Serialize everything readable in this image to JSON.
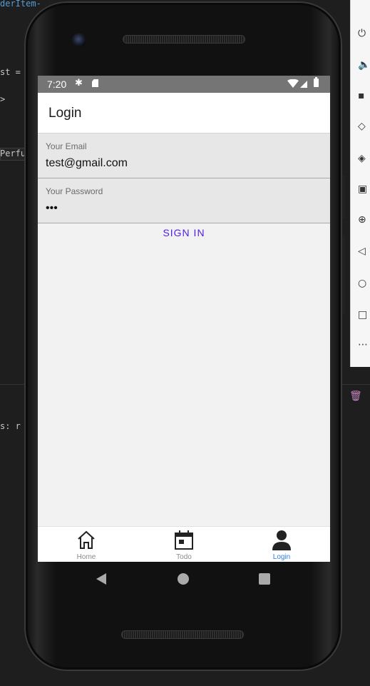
{
  "ide": {
    "code_lines": [
      "derItem-",
      "st =",
      ">",
      "Perfu",
      "s: r"
    ]
  },
  "status_bar": {
    "time": "7:20"
  },
  "app": {
    "title": "Login",
    "email": {
      "label": "Your Email",
      "value": "test@gmail.com"
    },
    "password": {
      "label": "Your Password",
      "value": "•••"
    },
    "sign_in_label": "SIGN IN"
  },
  "tabs": [
    {
      "label": "Home",
      "icon": "home-icon",
      "active": false
    },
    {
      "label": "Todo",
      "icon": "calendar-icon",
      "active": false
    },
    {
      "label": "Login",
      "icon": "person-icon",
      "active": true
    }
  ],
  "colors": {
    "accent": "#4f1ee8",
    "active_tab": "#2f7de9",
    "status_bar": "#757575"
  },
  "toolbar_icons": [
    "power-icon",
    "volume-up-icon",
    "volume-down-icon",
    "rotate-left-icon",
    "rotate-right-icon",
    "camera-icon",
    "zoom-icon",
    "back-icon",
    "home-icon",
    "overview-icon",
    "more-icon"
  ]
}
